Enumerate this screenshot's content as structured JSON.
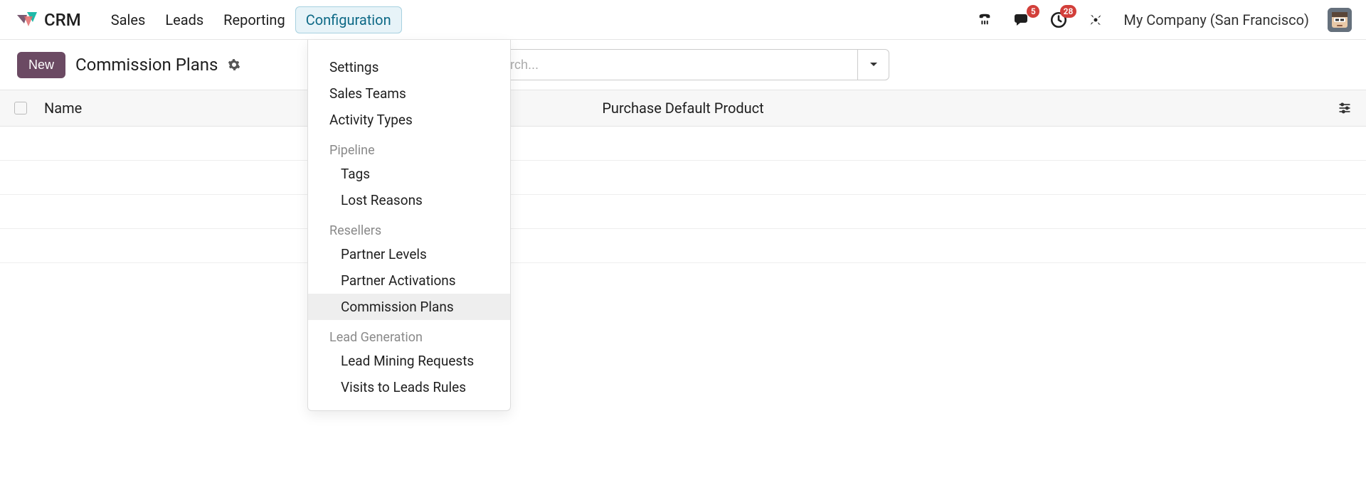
{
  "brand": {
    "text": "CRM"
  },
  "nav": {
    "items": [
      {
        "label": "Sales"
      },
      {
        "label": "Leads"
      },
      {
        "label": "Reporting"
      },
      {
        "label": "Configuration",
        "active": true
      }
    ]
  },
  "badges": {
    "messages": "5",
    "activities": "28"
  },
  "company": "My Company (San Francisco)",
  "action": {
    "new_label": "New",
    "page_title": "Commission Plans"
  },
  "search": {
    "placeholder": "Search..."
  },
  "columns": {
    "name": "Name",
    "product": "Purchase Default Product"
  },
  "dropdown": {
    "top": [
      {
        "label": "Settings"
      },
      {
        "label": "Sales Teams"
      },
      {
        "label": "Activity Types"
      }
    ],
    "sections": [
      {
        "header": "Pipeline",
        "items": [
          {
            "label": "Tags"
          },
          {
            "label": "Lost Reasons"
          }
        ]
      },
      {
        "header": "Resellers",
        "items": [
          {
            "label": "Partner Levels"
          },
          {
            "label": "Partner Activations"
          },
          {
            "label": "Commission Plans",
            "hover": true
          }
        ]
      },
      {
        "header": "Lead Generation",
        "items": [
          {
            "label": "Lead Mining Requests"
          },
          {
            "label": "Visits to Leads Rules"
          }
        ]
      }
    ]
  }
}
